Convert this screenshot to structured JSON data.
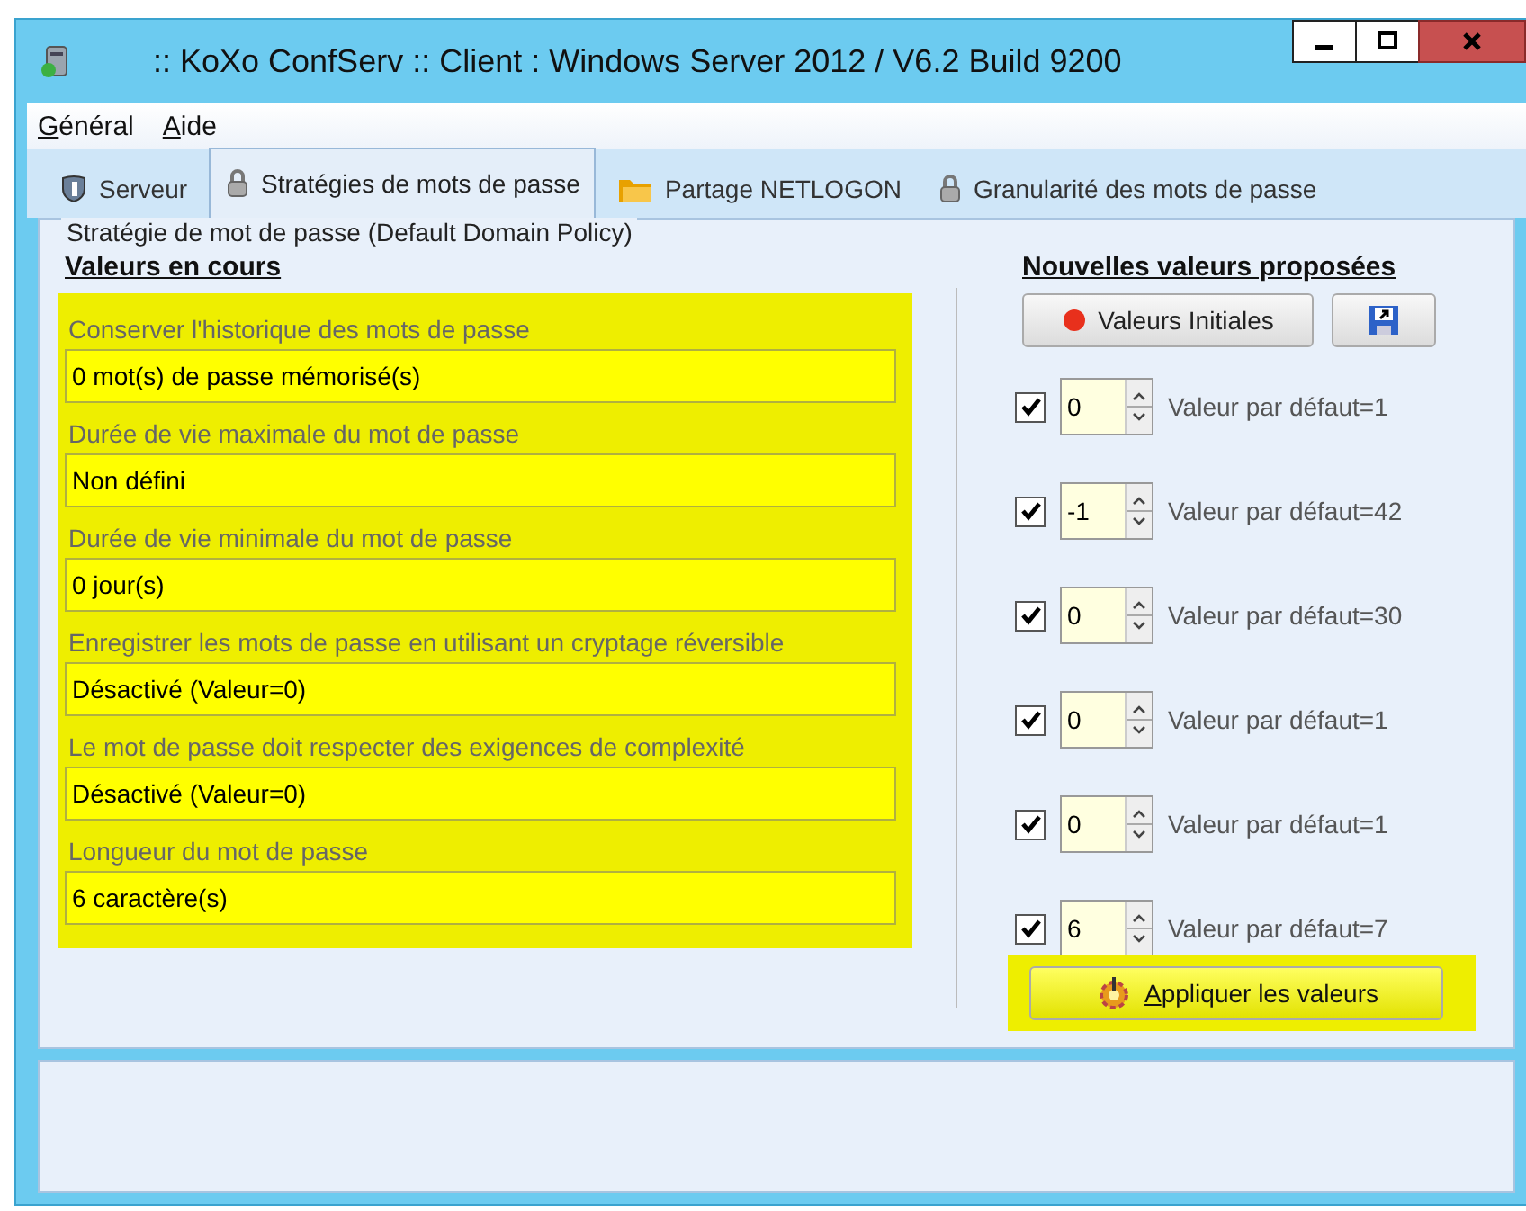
{
  "window": {
    "title": ":: KoXo ConfServ :: Client : Windows Server 2012 / V6.2 Build 9200"
  },
  "menu": [
    "Général",
    "Aide"
  ],
  "tabs": [
    {
      "label": "Serveur",
      "selected": false
    },
    {
      "label": "Stratégies de mots de passe",
      "selected": true
    },
    {
      "label": "Partage NETLOGON",
      "selected": false
    },
    {
      "label": "Granularité des mots de passe",
      "selected": false
    }
  ],
  "group_title": "Stratégie de mot de passe (Default Domain Policy)",
  "current_heading": "Valeurs en cours",
  "proposed_heading": "Nouvelles valeurs proposées",
  "reset_button": "Valeurs Initiales",
  "policies": [
    {
      "label": "Conserver l'historique des mots de passe",
      "value": "0 mot(s) de passe mémorisé(s)",
      "checked": true,
      "proposed": "0",
      "default": "Valeur par défaut=1"
    },
    {
      "label": "Durée de vie maximale du mot de passe",
      "value": "Non défini",
      "checked": true,
      "proposed": "-1",
      "default": "Valeur par défaut=42"
    },
    {
      "label": "Durée de vie minimale du mot de passe",
      "value": "0 jour(s)",
      "checked": true,
      "proposed": "0",
      "default": "Valeur par défaut=30"
    },
    {
      "label": "Enregistrer les mots de passe en utilisant un cryptage réversible",
      "value": "Désactivé (Valeur=0)",
      "checked": true,
      "proposed": "0",
      "default": "Valeur par défaut=1"
    },
    {
      "label": "Le mot de passe doit respecter des exigences de complexité",
      "value": "Désactivé (Valeur=0)",
      "checked": true,
      "proposed": "0",
      "default": "Valeur par défaut=1"
    },
    {
      "label": "Longueur du mot de passe",
      "value": "6 caractère(s)",
      "checked": true,
      "proposed": "6",
      "default": "Valeur par défaut=7"
    }
  ],
  "apply_button": "Appliquer les valeurs"
}
